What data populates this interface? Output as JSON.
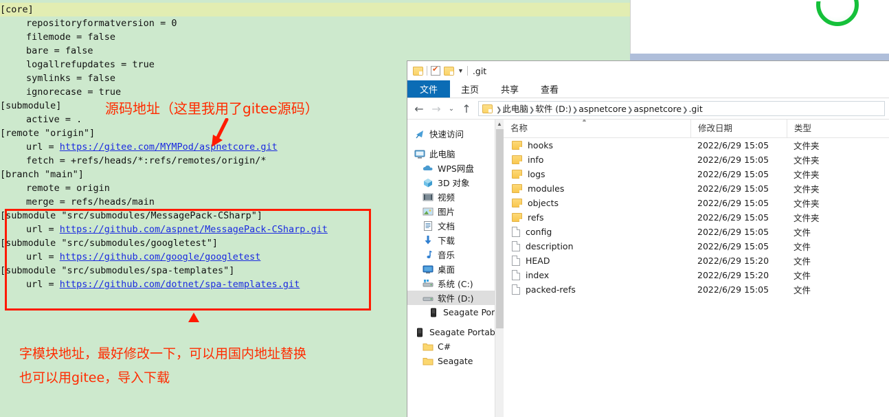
{
  "editor": {
    "lines": [
      {
        "text": "[core]",
        "indent": false,
        "highlight": true
      },
      {
        "text": "repositoryformatversion = 0",
        "indent": true,
        "highlight": false
      },
      {
        "text": "filemode = false",
        "indent": true,
        "highlight": false
      },
      {
        "text": "bare = false",
        "indent": true,
        "highlight": false
      },
      {
        "text": "logallrefupdates = true",
        "indent": true,
        "highlight": false
      },
      {
        "text": "symlinks = false",
        "indent": true,
        "highlight": false
      },
      {
        "text": "ignorecase = true",
        "indent": true,
        "highlight": false
      },
      {
        "text": "[submodule]",
        "indent": false,
        "highlight": false
      },
      {
        "text": "active = .",
        "indent": true,
        "highlight": false
      },
      {
        "text": "[remote \"origin\"]",
        "indent": false,
        "highlight": false
      },
      {
        "prefix": "url = ",
        "link": "https://gitee.com/MYMPod/aspnetcore.git",
        "indent": true,
        "highlight": false
      },
      {
        "text": "fetch = +refs/heads/*:refs/remotes/origin/*",
        "indent": true,
        "highlight": false
      },
      {
        "text": "[branch \"main\"]",
        "indent": false,
        "highlight": false
      },
      {
        "text": "remote = origin",
        "indent": true,
        "highlight": false
      },
      {
        "text": "merge = refs/heads/main",
        "indent": true,
        "highlight": false
      },
      {
        "text": "[submodule \"src/submodules/MessagePack-CSharp\"]",
        "indent": false,
        "highlight": false
      },
      {
        "prefix": "url = ",
        "link": "https://github.com/aspnet/MessagePack-CSharp.git",
        "indent": true,
        "highlight": false
      },
      {
        "text": "[submodule \"src/submodules/googletest\"]",
        "indent": false,
        "highlight": false
      },
      {
        "prefix": "url = ",
        "link": "https://github.com/google/googletest",
        "indent": true,
        "highlight": false
      },
      {
        "text": "[submodule \"src/submodules/spa-templates\"]",
        "indent": false,
        "highlight": false
      },
      {
        "prefix": "url = ",
        "link": "https://github.com/dotnet/spa-templates.git",
        "indent": true,
        "highlight": false
      }
    ]
  },
  "annotations": {
    "source_note": "源码地址（这里我用了gitee源码）",
    "submodule_note_line1": "字模块地址，最好修改一下，可以用国内地址替换",
    "submodule_note_line2": "也可以用gitee，导入下载",
    "accent_color": "#ff2b00",
    "box_color": "#ff1a00"
  },
  "explorer": {
    "title": ".git",
    "quick_access": [
      "folder-icon",
      "properties-icon",
      "new-folder-icon",
      "customize-caret-icon"
    ],
    "ribbon_tabs": [
      {
        "label": "文件",
        "active": true
      },
      {
        "label": "主页",
        "active": false
      },
      {
        "label": "共享",
        "active": false
      },
      {
        "label": "查看",
        "active": false
      }
    ],
    "nav_buttons": {
      "back": "←",
      "forward": "→",
      "recent": "⌄",
      "up": "↑"
    },
    "breadcrumb": [
      "此电脑",
      "软件 (D:)",
      "aspnetcore",
      "aspnetcore",
      ".git"
    ],
    "sidebar": [
      {
        "label": "快速访问",
        "icon": "pin-star-icon",
        "level": 0,
        "selected": false,
        "gap_before": false
      },
      {
        "label": "此电脑",
        "icon": "this-pc-icon",
        "level": 0,
        "selected": false,
        "gap_before": true
      },
      {
        "label": "WPS网盘",
        "icon": "cloud-icon",
        "level": 1,
        "selected": false,
        "gap_before": false
      },
      {
        "label": "3D 对象",
        "icon": "3d-objects-icon",
        "level": 1,
        "selected": false,
        "gap_before": false
      },
      {
        "label": "视频",
        "icon": "videos-icon",
        "level": 1,
        "selected": false,
        "gap_before": false
      },
      {
        "label": "图片",
        "icon": "pictures-icon",
        "level": 1,
        "selected": false,
        "gap_before": false
      },
      {
        "label": "文档",
        "icon": "documents-icon",
        "level": 1,
        "selected": false,
        "gap_before": false
      },
      {
        "label": "下载",
        "icon": "downloads-icon",
        "level": 1,
        "selected": false,
        "gap_before": false
      },
      {
        "label": "音乐",
        "icon": "music-icon",
        "level": 1,
        "selected": false,
        "gap_before": false
      },
      {
        "label": "桌面",
        "icon": "desktop-icon",
        "level": 1,
        "selected": false,
        "gap_before": false
      },
      {
        "label": "系统 (C:)",
        "icon": "system-drive-icon",
        "level": 1,
        "selected": false,
        "gap_before": false
      },
      {
        "label": "软件 (D:)",
        "icon": "drive-icon",
        "level": 1,
        "selected": true,
        "gap_before": false
      },
      {
        "label": "Seagate Portabl",
        "icon": "portable-drive-icon",
        "level": 2,
        "selected": false,
        "gap_before": false
      },
      {
        "label": "Seagate Portabl",
        "icon": "portable-drive-icon",
        "level": 0,
        "selected": false,
        "gap_before": true
      },
      {
        "label": "C#",
        "icon": "folder-icon",
        "level": 1,
        "selected": false,
        "gap_before": false
      },
      {
        "label": "Seagate",
        "icon": "folder-icon",
        "level": 1,
        "selected": false,
        "gap_before": false
      }
    ],
    "columns": [
      "名称",
      "修改日期",
      "类型"
    ],
    "files": [
      {
        "name": "hooks",
        "date": "2022/6/29 15:05",
        "type": "文件夹",
        "kind": "folder"
      },
      {
        "name": "info",
        "date": "2022/6/29 15:05",
        "type": "文件夹",
        "kind": "folder"
      },
      {
        "name": "logs",
        "date": "2022/6/29 15:05",
        "type": "文件夹",
        "kind": "folder"
      },
      {
        "name": "modules",
        "date": "2022/6/29 15:05",
        "type": "文件夹",
        "kind": "folder"
      },
      {
        "name": "objects",
        "date": "2022/6/29 15:05",
        "type": "文件夹",
        "kind": "folder"
      },
      {
        "name": "refs",
        "date": "2022/6/29 15:05",
        "type": "文件夹",
        "kind": "folder"
      },
      {
        "name": "config",
        "date": "2022/6/29 15:05",
        "type": "文件",
        "kind": "file"
      },
      {
        "name": "description",
        "date": "2022/6/29 15:05",
        "type": "文件",
        "kind": "file"
      },
      {
        "name": "HEAD",
        "date": "2022/6/29 15:20",
        "type": "文件",
        "kind": "file"
      },
      {
        "name": "index",
        "date": "2022/6/29 15:20",
        "type": "文件",
        "kind": "file"
      },
      {
        "name": "packed-refs",
        "date": "2022/6/29 15:05",
        "type": "文件",
        "kind": "file"
      }
    ]
  }
}
